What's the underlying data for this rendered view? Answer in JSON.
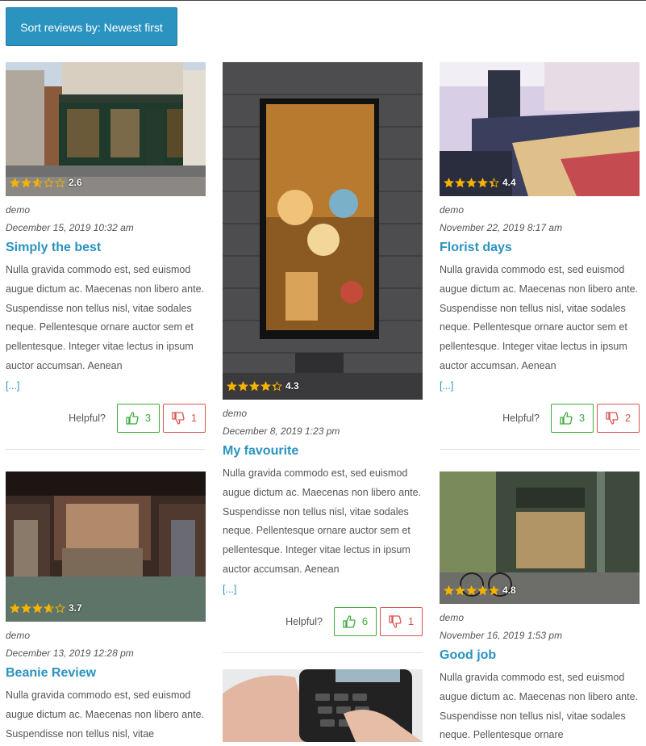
{
  "sort_button": "Sort reviews by: Newest first",
  "helpful_label": "Helpful?",
  "more_label": "[...]",
  "reviews": [
    {
      "rating": "2.6",
      "stars_filled": 2.6,
      "author": "demo",
      "date": "December 15, 2019 10:32 am",
      "title": "Simply the best",
      "body": "Nulla gravida commodo est, sed euismod augue dictum ac. Maecenas non libero ante. Suspendisse non tellus nisl, vitae sodales neque. Pellentesque ornare auctor sem et pellentesque. Integer vitae lectus in ipsum auctor accumsan. Aenean",
      "up": "3",
      "down": "1"
    },
    {
      "rating": "4.3",
      "stars_filled": 4.3,
      "author": "demo",
      "date": "December 8, 2019 1:23 pm",
      "title": "My favourite",
      "body": "Nulla gravida commodo est, sed euismod augue dictum ac. Maecenas non libero ante. Suspendisse non tellus nisl, vitae sodales neque. Pellentesque ornare auctor sem et pellentesque. Integer vitae lectus in ipsum auctor accumsan. Aenean",
      "up": "6",
      "down": "1"
    },
    {
      "rating": "4.4",
      "stars_filled": 4.4,
      "author": "demo",
      "date": "November 22, 2019 8:17 am",
      "title": "Florist days",
      "body": "Nulla gravida commodo est, sed euismod augue dictum ac. Maecenas non libero ante. Suspendisse non tellus nisl, vitae sodales neque. Pellentesque ornare auctor sem et pellentesque. Integer vitae lectus in ipsum auctor accumsan. Aenean",
      "up": "3",
      "down": "2"
    },
    {
      "rating": "3.7",
      "stars_filled": 3.7,
      "author": "demo",
      "date": "December 13, 2019 12:28 pm",
      "title": "Beanie Review",
      "body": "Nulla gravida commodo est, sed euismod augue dictum ac. Maecenas non libero ante. Suspendisse non tellus nisl, vitae"
    },
    {
      "rating": "4.8",
      "stars_filled": 4.8,
      "author": "demo",
      "date": "November 16, 2019 1:53 pm",
      "title": "Good job",
      "body": "Nulla gravida commodo est, sed euismod augue dictum ac. Maecenas non libero ante. Suspendisse non tellus nisl, vitae sodales neque. Pellentesque ornare"
    }
  ],
  "colors": {
    "accent": "#2a93bf",
    "star": "#f5b301",
    "up": "#3cab3c",
    "down": "#d9534f"
  }
}
